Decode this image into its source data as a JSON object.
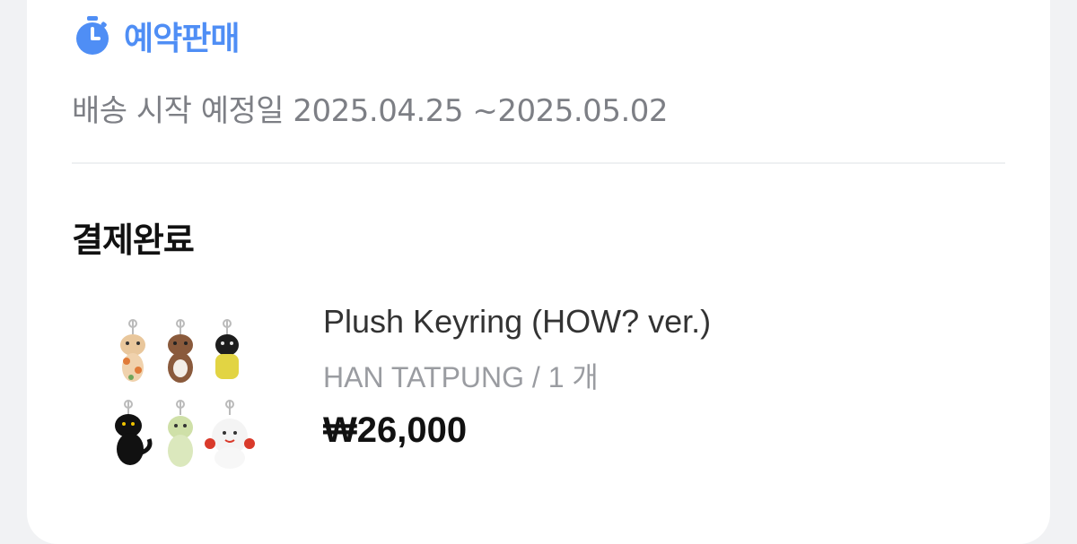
{
  "order": {
    "badge": {
      "icon": "stopwatch-icon",
      "label": "예약판매",
      "color": "#4f8ef5"
    },
    "shipping_info": "배송 시작 예정일 2025.04.25 ~2025.05.02",
    "status": "결제완료",
    "item": {
      "image_icon": "plush-keyring-set-image",
      "name": "Plush Keyring (HOW? ver.)",
      "option": "HAN TATPUNG / 1 개",
      "price": "₩26,000"
    }
  }
}
